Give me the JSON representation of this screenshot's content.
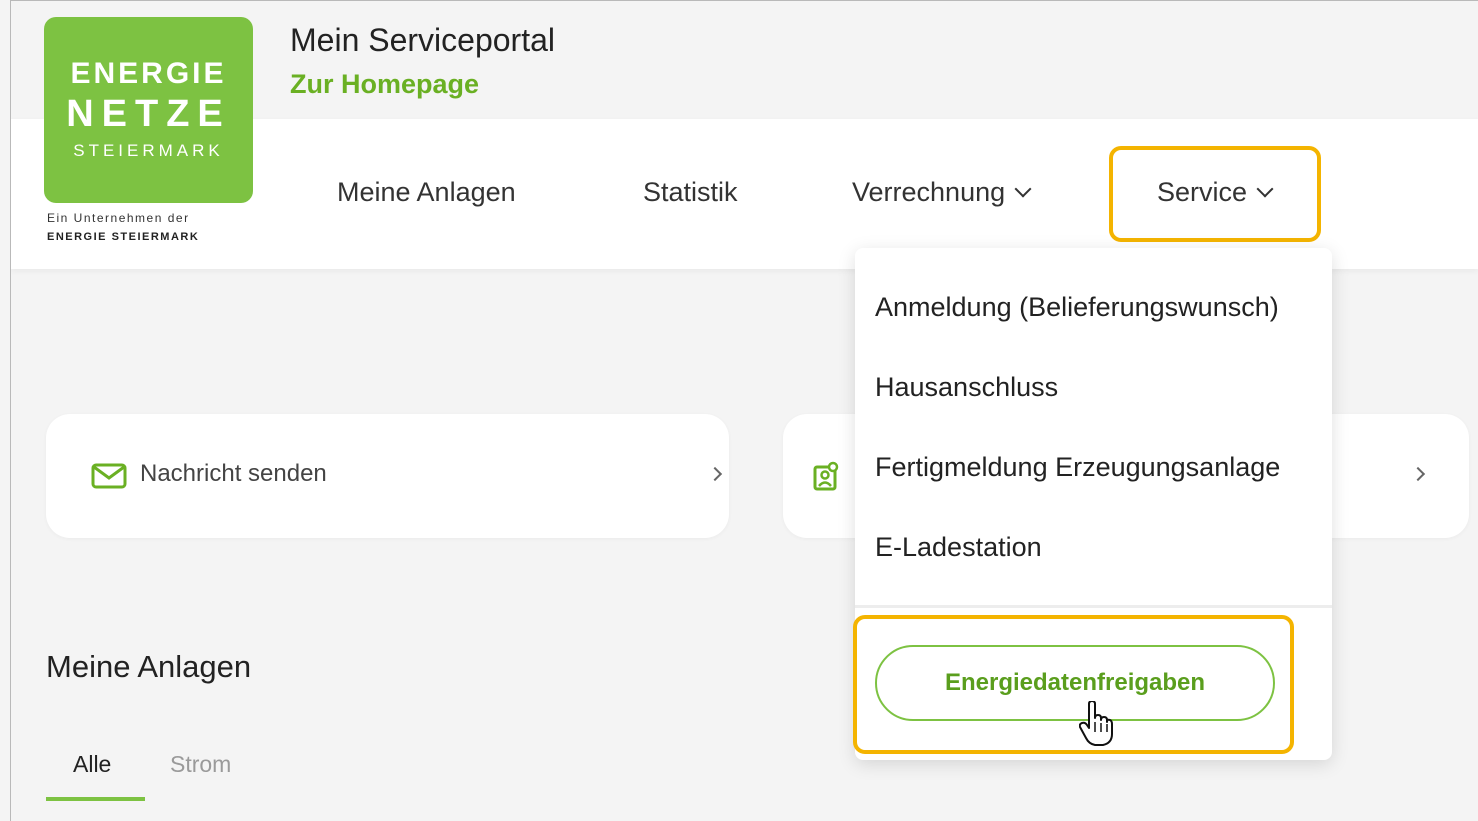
{
  "logo": {
    "line1": "ENERGIE",
    "line2": "NETZE",
    "line3": "STEIERMARK",
    "sub1": "Ein Unternehmen der",
    "sub2": "ENERGIE STEIERMARK"
  },
  "header": {
    "title": "Mein Serviceportal",
    "homepage_link": "Zur Homepage"
  },
  "nav": {
    "items": [
      {
        "label": "Meine Anlagen"
      },
      {
        "label": "Statistik"
      },
      {
        "label": "Verrechnung"
      },
      {
        "label": "Service"
      }
    ]
  },
  "dropdown": {
    "items": [
      {
        "label": "Anmeldung (Belieferungswunsch)"
      },
      {
        "label": "Hausanschluss"
      },
      {
        "label": "Fertigmeldung Erzeugungsanlage"
      },
      {
        "label": "E-Ladestation"
      }
    ],
    "button": "Energiedatenfreigaben"
  },
  "cards": [
    {
      "label": "Nachricht senden",
      "icon": "mail-icon"
    },
    {
      "label": "",
      "icon": "contact-card-icon"
    }
  ],
  "section": {
    "title": "Meine Anlagen",
    "tabs": [
      {
        "label": "Alle",
        "active": true
      },
      {
        "label": "Strom",
        "active": false
      }
    ]
  },
  "colors": {
    "brand_green": "#7dc242",
    "link_green": "#6ab023",
    "highlight": "#f4b400"
  }
}
